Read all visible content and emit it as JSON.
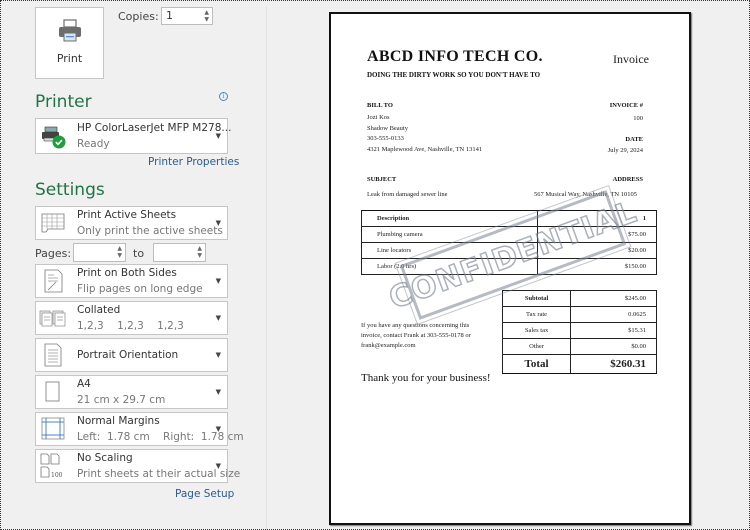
{
  "print": {
    "print_label": "Print",
    "copies_label": "Copies:",
    "copies_value": "1"
  },
  "printer": {
    "section_title": "Printer",
    "info_icon": "i",
    "name": "HP ColorLaserJet MFP M278...",
    "status": "Ready",
    "properties_link": "Printer Properties"
  },
  "settings": {
    "section_title": "Settings",
    "items": [
      {
        "title": "Print Active Sheets",
        "subtitle": "Only print the active sheets",
        "icon": "sheets-icon"
      },
      {
        "title": "Print on Both Sides",
        "subtitle": "Flip pages on long edge",
        "icon": "duplex-icon"
      },
      {
        "title": "Collated",
        "subtitle": "1,2,3    1,2,3    1,2,3",
        "icon": "collated-icon"
      },
      {
        "title": "Portrait Orientation",
        "subtitle": "",
        "icon": "portrait-icon"
      },
      {
        "title": "A4",
        "subtitle": "21 cm x 29.7 cm",
        "icon": "paper-size-icon"
      },
      {
        "title": "Normal Margins",
        "subtitle": "Left:  1.78 cm    Right:  1.78 cm",
        "icon": "margins-icon"
      },
      {
        "title": "No Scaling",
        "subtitle": "Print sheets at their actual size",
        "icon": "scaling-icon"
      }
    ],
    "pages_label": "Pages:",
    "to_label": "to",
    "pages_from": "",
    "pages_to": "",
    "page_setup_link": "Page Setup"
  },
  "invoice": {
    "company": "ABCD INFO TECH CO.",
    "title": "Invoice",
    "tagline": "DOING THE DIRTY WORK SO YOU DON'T HAVE TO",
    "bill_to_label": "BILL TO",
    "bill_to": [
      "Jozi Kos",
      "Shadow Beauty",
      "303-555-0133",
      "4321 Maplewood Ave, Nashville, TN 13141"
    ],
    "invoice_no_label": "INVOICE #",
    "invoice_no": "100",
    "date_label": "DATE",
    "date": "July 29, 2024",
    "subject_label": "SUBJECT",
    "subject": "Leak from damaged sewer line",
    "address_label": "ADDRESS",
    "address": "567 Musical Way, Nashville, TN 10105",
    "items_header": {
      "description": "Description",
      "amount": "1"
    },
    "items": [
      {
        "description": "Plumbing camera",
        "amount": "$75.00"
      },
      {
        "description": "Line locators",
        "amount": "$20.00"
      },
      {
        "description": "Labor (2.0 hrs)",
        "amount": "$150.00"
      }
    ],
    "totals": [
      {
        "label": "Subtotal",
        "value": "$245.00"
      },
      {
        "label": "Tax rate",
        "value": "0.0625"
      },
      {
        "label": "Sales tax",
        "value": "$15.31"
      },
      {
        "label": "Other",
        "value": "$0.00"
      }
    ],
    "total_label": "Total",
    "total_value": "$260.31",
    "contact_note": [
      "If you have any questions concerning this",
      "invoice, contact Frank at 303-555-0178 or",
      "frank@example.com"
    ],
    "thanks": "Thank you for your business!",
    "watermark": "CONFIDENTIAL"
  },
  "colors": {
    "accent_green": "#217346",
    "link_blue": "#2a5a8f",
    "status_ok": "#1e9e3c"
  }
}
